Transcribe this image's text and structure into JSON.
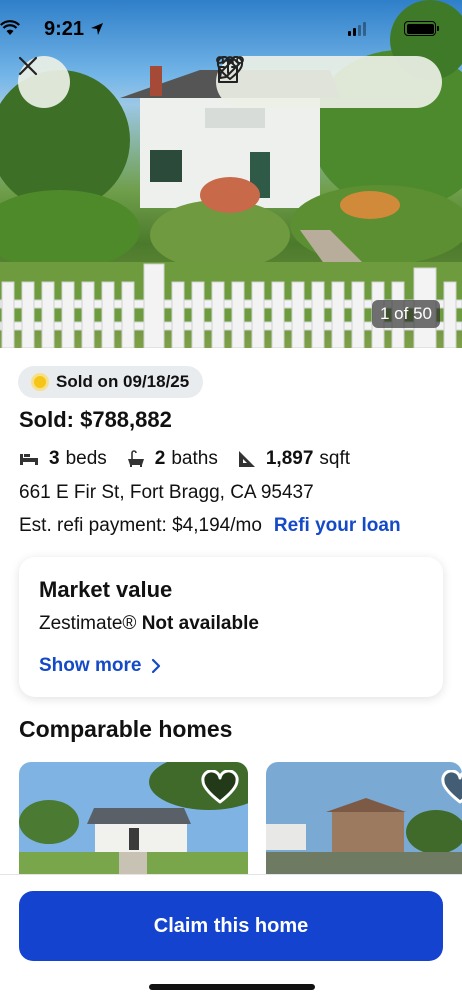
{
  "status_bar": {
    "time": "9:21"
  },
  "hero": {
    "photo_counter": "1 of 50"
  },
  "listing": {
    "sold_badge": "Sold on 09/18/25",
    "price": "Sold: $788,882",
    "beds_value": "3",
    "beds_label": "beds",
    "baths_value": "2",
    "baths_label": "baths",
    "sqft_value": "1,897",
    "sqft_label": "sqft",
    "address": "661 E Fir St, Fort Bragg, CA 95437",
    "refi_text": "Est. refi payment: $4,194/mo",
    "refi_link": "Refi your loan"
  },
  "market_value": {
    "title": "Market value",
    "zestimate_label": "Zestimate®",
    "zestimate_value": "Not available",
    "show_more": "Show more"
  },
  "comparable": {
    "title": "Comparable homes"
  },
  "cta": {
    "claim_label": "Claim this home"
  },
  "colors": {
    "accent": "#1443d0",
    "link": "#1449c8",
    "sold_dot": "#f5c518"
  }
}
